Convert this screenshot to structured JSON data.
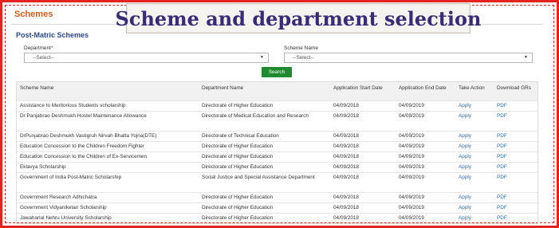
{
  "title_banner": "Scheme and department selection",
  "section_title": "Schemes",
  "subsection_title": "Post-Matric Schemes",
  "form": {
    "department_label": "Department",
    "department_required_mark": "*",
    "department_value": "--Select--",
    "scheme_label": "Scheme Name",
    "scheme_value": "--Select--",
    "search_label": "Search"
  },
  "table": {
    "headers": [
      "Scheme Name",
      "Department Name",
      "Application Start Date",
      "Application End Date",
      "Take Action",
      "Download GRs"
    ],
    "rows": [
      {
        "scheme": "Assistance to Meritorious Students scholarship",
        "department": "Directorate of Higher Education",
        "start": "04/09/2018",
        "end": "04/09/2019",
        "action": "Apply",
        "download": "PDF"
      },
      {
        "scheme": "Dr Panjabrao Deshmukh Hostel Maintenance Allowance",
        "department": "Directorate of Medical Education and Research",
        "start": "04/09/2018",
        "end": "04/09/2019",
        "action": "Apply",
        "download": "PDF"
      },
      {
        "scheme": "DrPunjabrao Deshmukh Vastigruh Nirvah Bhatta Yojna(DTE)",
        "department": "Directorate of Technical Education",
        "start": "04/09/2018",
        "end": "04/09/2019",
        "action": "Apply",
        "download": "PDF"
      },
      {
        "scheme": "Education Concession to the Children Freedom Fighter",
        "department": "Directorate of Higher Education",
        "start": "04/09/2018",
        "end": "04/09/2019",
        "action": "Apply",
        "download": "PDF"
      },
      {
        "scheme": "Education Concession to the Children of Ex-Servicemen",
        "department": "Directorate of Higher Education",
        "start": "04/09/2018",
        "end": "04/09/2019",
        "action": "Apply",
        "download": "PDF"
      },
      {
        "scheme": "Eklavya Scholarship",
        "department": "Directorate of Higher Education",
        "start": "04/09/2018",
        "end": "04/09/2019",
        "action": "Apply",
        "download": "PDF"
      },
      {
        "scheme": "Government of India Post-Matric Scholarship",
        "department": "Social Justice and Special Assistance Department",
        "start": "04/09/2018",
        "end": "04/09/2019",
        "action": "Apply",
        "download": "PDF"
      },
      {
        "scheme": "Government Research Adhichatra",
        "department": "Directorate of Higher Education",
        "start": "04/09/2018",
        "end": "04/09/2019",
        "action": "Apply",
        "download": "PDF"
      },
      {
        "scheme": "Government Vidyaniketan Scholarship",
        "department": "Directorate of Higher Education",
        "start": "04/09/2018",
        "end": "04/09/2019",
        "action": "Apply",
        "download": "PDF"
      },
      {
        "scheme": "Jawaharlal Nehru University Scholarship",
        "department": "Directorate of Higher Education",
        "start": "04/09/2018",
        "end": "04/09/2019",
        "action": "Apply",
        "download": "PDF"
      }
    ]
  },
  "colors": {
    "frame_border": "#e52420",
    "banner_text": "#3a2a78",
    "section_title": "#e05a1a",
    "subsection_title": "#2a4a8a",
    "search_button": "#1f8a2e",
    "link": "#2a6fb5"
  },
  "icons": {
    "select_caret": "caret-down-icon"
  }
}
